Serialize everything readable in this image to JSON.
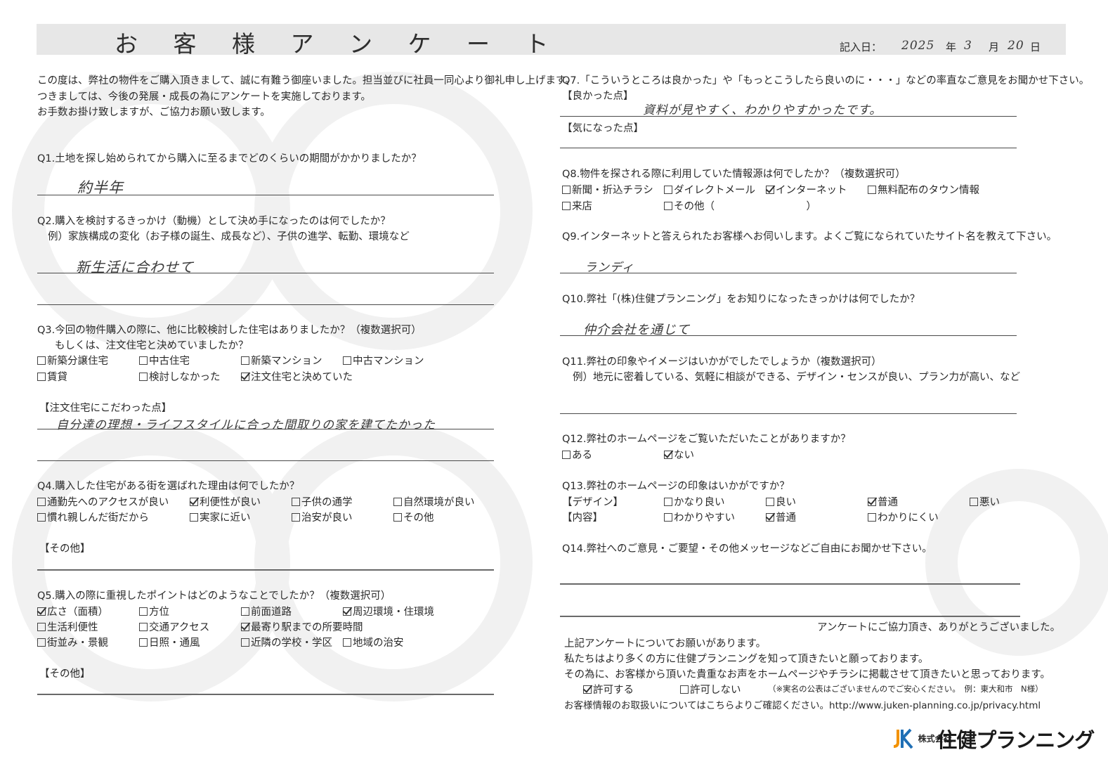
{
  "header": {
    "title": "お 客 様 ア ン ケ ー ト",
    "date_label": "記入日：",
    "date_year": "2025",
    "year_unit": "年",
    "date_month": "3",
    "month_unit": "月",
    "date_day": "20",
    "day_unit": "日"
  },
  "intro": [
    "この度は、弊社の物件をご購入頂きまして、誠に有難う御座いました。担当並びに社員一同心より御礼申し上げます。",
    "つきましては、今後の発展・成長の為にアンケートを実施しております。",
    "お手数お掛け致しますが、ご協力お願い致します。"
  ],
  "q1": {
    "question": "Q1.土地を探し始められてから購入に至るまでどのくらいの期間がかかりましたか？",
    "answer": "約半年"
  },
  "q2": {
    "question": "Q2.購入を検討するきっかけ（動機）として決め手になったのは何でしたか？",
    "example": "例）家族構成の変化（お子様の誕生、成長など）、子供の進学、転勤、環境など",
    "answer": "新生活に合わせて"
  },
  "q3": {
    "question": "Q3.今回の物件購入の際に、他に比較検討した住宅はありましたか？（複数選択可）",
    "question2": "もしくは、注文住宅と決めていましたか？",
    "options": [
      {
        "label": "新築分譲住宅",
        "checked": false
      },
      {
        "label": "中古住宅",
        "checked": false
      },
      {
        "label": "新築マンション",
        "checked": false
      },
      {
        "label": "中古マンション",
        "checked": false
      },
      {
        "label": "賃貸",
        "checked": false
      },
      {
        "label": "検討しなかった",
        "checked": false
      },
      {
        "label": "注文住宅と決めていた",
        "checked": true
      }
    ],
    "sub_label": "【注文住宅にこだわった点】",
    "sub_answer": "自分達の理想・ライフスタイルに合った間取りの家を建てたかった"
  },
  "q4": {
    "question": "Q4.購入した住宅がある街を選ばれた理由は何でしたか？",
    "options": [
      {
        "label": "通勤先へのアクセスが良い",
        "checked": false
      },
      {
        "label": "利便性が良い",
        "checked": true
      },
      {
        "label": "子供の通学",
        "checked": false
      },
      {
        "label": "自然環境が良い",
        "checked": false
      },
      {
        "label": "慣れ親しんだ街だから",
        "checked": false
      },
      {
        "label": "実家に近い",
        "checked": false
      },
      {
        "label": "治安が良い",
        "checked": false
      },
      {
        "label": "その他",
        "checked": false
      }
    ],
    "other_label": "【その他】"
  },
  "q5": {
    "question": "Q5.購入の際に重視したポイントはどのようなことでしたか？（複数選択可）",
    "options": [
      {
        "label": "広さ（面積）",
        "checked": true
      },
      {
        "label": "方位",
        "checked": false
      },
      {
        "label": "前面道路",
        "checked": false
      },
      {
        "label": "周辺環境・住環境",
        "checked": true
      },
      {
        "label": "生活利便性",
        "checked": false
      },
      {
        "label": "交通アクセス",
        "checked": false
      },
      {
        "label": "最寄り駅までの所要時間",
        "checked": true
      },
      {
        "label": "街並み・景観",
        "checked": false
      },
      {
        "label": "日照・通風",
        "checked": false
      },
      {
        "label": "近隣の学校・学区",
        "checked": false
      },
      {
        "label": "地域の治安",
        "checked": false
      }
    ],
    "other_label": "【その他】"
  },
  "q7": {
    "question": "Q7.「こういうところは良かった」や「もっとこうしたら良いのに・・・」などの率直なご意見をお聞かせ下さい。",
    "good_label": "【良かった点】",
    "good_answer": "資料が見やすく、わかりやすかったです。",
    "concern_label": "【気になった点】"
  },
  "q8": {
    "question": "Q8.物件を探される際に利用していた情報源は何でしたか？（複数選択可）",
    "options": [
      {
        "label": "新聞・折込チラシ",
        "checked": false
      },
      {
        "label": "ダイレクトメール",
        "checked": false
      },
      {
        "label": "インターネット",
        "checked": true
      },
      {
        "label": "無料配布のタウン情報",
        "checked": false
      },
      {
        "label": "来店",
        "checked": false
      },
      {
        "label": "その他（　　　　　　　　　）",
        "checked": false
      }
    ]
  },
  "q9": {
    "question": "Q9.インターネットと答えられたお客様へお伺いします。よくご覧になられていたサイト名を教えて下さい。",
    "answer": "ランディ"
  },
  "q10": {
    "question": "Q10.弊社「(株)住健プランニング」をお知りになったきっかけは何でしたか？",
    "answer": "仲介会社を通じて"
  },
  "q11": {
    "question": "Q11.弊社の印象やイメージはいかがでしたでしょうか（複数選択可）",
    "example": "例）地元に密着している、気軽に相談ができる、デザイン・センスが良い、プラン力が高い、など"
  },
  "q12": {
    "question": "Q12.弊社のホームページをご覧いただいたことがありますか？",
    "options": [
      {
        "label": "ある",
        "checked": false
      },
      {
        "label": "ない",
        "checked": true
      }
    ]
  },
  "q13": {
    "question": "Q13.弊社のホームページの印象はいかがですか？",
    "design_label": "【デザイン】",
    "design_options": [
      {
        "label": "かなり良い",
        "checked": false
      },
      {
        "label": "良い",
        "checked": false
      },
      {
        "label": "普通",
        "checked": true
      },
      {
        "label": "悪い",
        "checked": false
      }
    ],
    "content_label": "【内容】",
    "content_options": [
      {
        "label": "わかりやすい",
        "checked": false
      },
      {
        "label": "普通",
        "checked": true
      },
      {
        "label": "わかりにくい",
        "checked": false
      }
    ]
  },
  "q14": {
    "question": "Q14.弊社へのご意見・ご要望・その他メッセージなどご自由にお聞かせ下さい。"
  },
  "closing": {
    "thanks": "アンケートにご協力頂き、ありがとうございました。",
    "request1": "上記アンケートについてお願いがあります。",
    "request2": "私たちはより多くの方に住健プランニングを知って頂きたいと願っております。",
    "request3": "その為に、お客様から頂いた貴重なお声をホームページやチラシに掲載させて頂きたいと思っております。",
    "permit": {
      "label": "許可する",
      "checked": true
    },
    "deny": {
      "label": "許可しない",
      "checked": false
    },
    "note": "（※実名の公表はございませんのでご安心ください。　例：東大和市　N様）",
    "privacy": "お客様情報のお取扱いについてはこちらよりご確認ください。http://www.juken-planning.co.jp/privacy.html"
  },
  "logo": {
    "kk": "株式会社",
    "name": "住健プランニング"
  }
}
